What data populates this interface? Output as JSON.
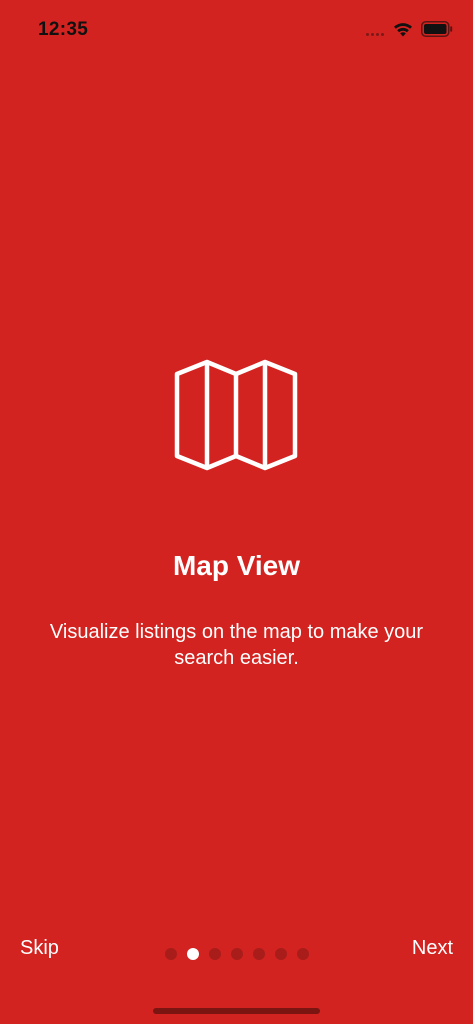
{
  "status_bar": {
    "time": "12:35"
  },
  "onboarding": {
    "icon": "map-icon",
    "title": "Map View",
    "description": "Visualize listings on the map to make your search easier."
  },
  "navigation": {
    "skip_label": "Skip",
    "next_label": "Next",
    "page_count": 7,
    "current_page": 2
  },
  "colors": {
    "background": "#d22320",
    "text": "#ffffff",
    "dot_inactive": "#a81d1a",
    "dot_active": "#ffffff"
  }
}
